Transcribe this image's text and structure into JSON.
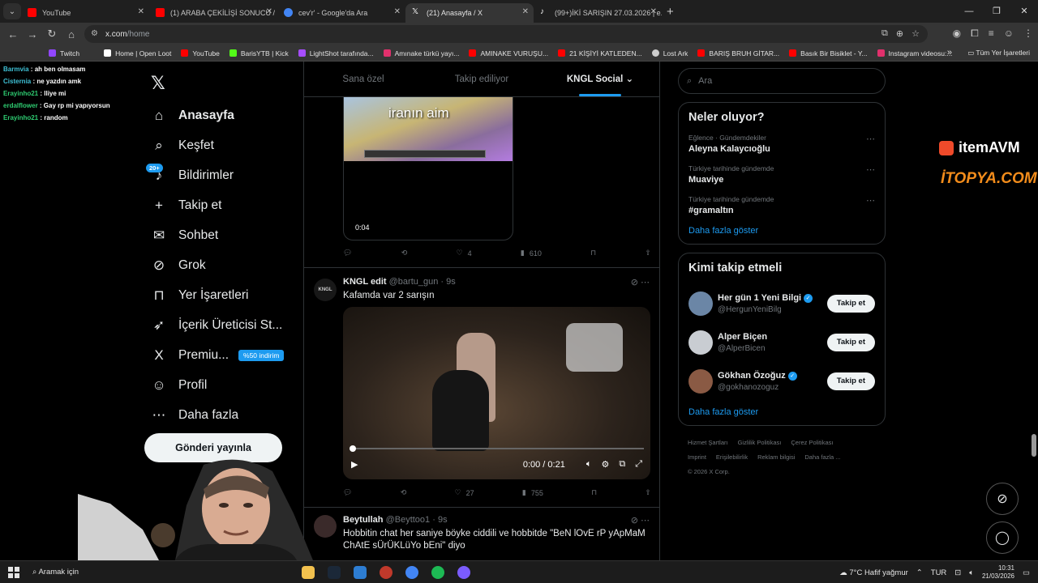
{
  "browser": {
    "tabs": [
      {
        "title": "YouTube",
        "color": "#ff0000",
        "active": false
      },
      {
        "title": "(1) ARABA ÇEKİLİŞİ SONUCU / ...",
        "color": "#ff0000",
        "active": false
      },
      {
        "title": "cev'r' - Google'da Ara",
        "color": "#4285f4",
        "active": false
      },
      {
        "title": "(21) Anasayfa / X",
        "color": "#000000",
        "active": true
      },
      {
        "title": "(99+)İKİ SARIŞIN 27.03.2026 | e...",
        "color": "#111111",
        "active": false
      }
    ],
    "url_domain": "x.com",
    "url_path": "/home",
    "bookmarks": [
      {
        "label": "Twitch",
        "color": "#9146ff"
      },
      {
        "label": "Home | Open Loot",
        "color": "#ffffff"
      },
      {
        "label": "YouTube",
        "color": "#ff0000"
      },
      {
        "label": "BarisYTB | Kick",
        "color": "#53fc18"
      },
      {
        "label": "LightShot tarafında...",
        "color": "#a64dff"
      },
      {
        "label": "Amınake türkü yayı...",
        "color": "#e1306c"
      },
      {
        "label": "AMINAKE VURUŞU...",
        "color": "#ff0000"
      },
      {
        "label": "21 KİŞİYİ KATLEDEN...",
        "color": "#ff0000"
      },
      {
        "label": "Lost Ark",
        "color": "#cccccc"
      },
      {
        "label": "BARIŞ BRUH GİTAR...",
        "color": "#ff0000"
      },
      {
        "label": "Basık Bir Bisiklet - Y...",
        "color": "#ff0000"
      },
      {
        "label": "Instagram videosu:...",
        "color": "#e1306c"
      }
    ],
    "all_bookmarks": "Tüm Yer İşaretleri"
  },
  "chat": [
    {
      "user": "Barmvia",
      "text": "ah ben olmasam"
    },
    {
      "user": "Cisternia",
      "text": "ne yazdın amk"
    },
    {
      "user": "Erayinho21",
      "text": "lliye mi"
    },
    {
      "user": "erdalflower",
      "text": "Gay rp mi yapıyorsun"
    },
    {
      "user": "Erayinho21",
      "text": "random"
    }
  ],
  "sidebar": {
    "items": [
      {
        "label": "Anasayfa",
        "icon": "⌂"
      },
      {
        "label": "Keşfet",
        "icon": "⌕"
      },
      {
        "label": "Bildirimler",
        "icon": "♪",
        "badge": "20+"
      },
      {
        "label": "Takip et",
        "icon": "+"
      },
      {
        "label": "Sohbet",
        "icon": "✉"
      },
      {
        "label": "Grok",
        "icon": "⊘"
      },
      {
        "label": "Yer İşaretleri",
        "icon": "⊓"
      },
      {
        "label": "İçerik Üreticisi St...",
        "icon": "➶"
      },
      {
        "label": "Premiu...",
        "icon": "X",
        "promo": "%50 indirim"
      },
      {
        "label": "Profil",
        "icon": "☺"
      },
      {
        "label": "Daha fazla",
        "icon": "⋯"
      }
    ],
    "post_button": "Gönderi yayınla"
  },
  "feed": {
    "tabs": [
      "Sana özel",
      "Takip ediliyor",
      "KNGL Social"
    ],
    "post1": {
      "caption": "iranın aim",
      "duration": "0:04",
      "replies": "",
      "reposts": "",
      "likes": "4",
      "views": "610"
    },
    "post2": {
      "author": "KNGL edit",
      "handle": "@bartu_gun",
      "time": "9s",
      "text": "Kafamda var 2 sarışın",
      "video_time": "0:00 / 0:21",
      "likes": "27",
      "views": "755"
    },
    "post3": {
      "author": "Beytullah",
      "handle": "@Beyttoo1",
      "time": "9s",
      "text": "Hobbitin chat her saniye böyke ciddili ve hobbitde \"BeN lOvE rP yApMaM ChAtE sÜrÜKLüYo bEni\" diyo"
    }
  },
  "right": {
    "search_placeholder": "Ara",
    "trends_title": "Neler oluyor?",
    "trends": [
      {
        "category": "Eğlence · Gündemdekiler",
        "name": "Aleyna Kalaycıoğlu"
      },
      {
        "category": "Türkiye tarihinde gündemde",
        "name": "Muaviye"
      },
      {
        "category": "Türkiye tarihinde gündemde",
        "name": "#gramaltın"
      }
    ],
    "show_more": "Daha fazla göster",
    "who_title": "Kimi takip etmeli",
    "follow": [
      {
        "name": "Her gün 1 Yeni Bilgi",
        "handle": "@HergunYeniBilg",
        "verified": true,
        "color": "#6b86a6"
      },
      {
        "name": "Alper Biçen",
        "handle": "@AlperBicen",
        "verified": false,
        "color": "#c9cdd2"
      },
      {
        "name": "Gökhan Özoğuz",
        "handle": "@gokhanozoguz",
        "verified": true,
        "color": "#8a5a44"
      }
    ],
    "follow_button": "Takip et",
    "footer": [
      "Hizmet Şartları",
      "Gizlilik Politikası",
      "Çerez Politikası",
      "Imprint",
      "Erişilebilirlik",
      "Reklam bilgisi",
      "Daha fazla ...",
      "© 2026 X Corp."
    ]
  },
  "overlay": {
    "brand1": "itemAVM",
    "brand2": "İTOPYA.COM"
  },
  "taskbar": {
    "search": "Aramak için",
    "weather": "7°C  Hafif yağmur",
    "lang": "TUR",
    "time": "10:31",
    "date": "21/03/2026"
  }
}
